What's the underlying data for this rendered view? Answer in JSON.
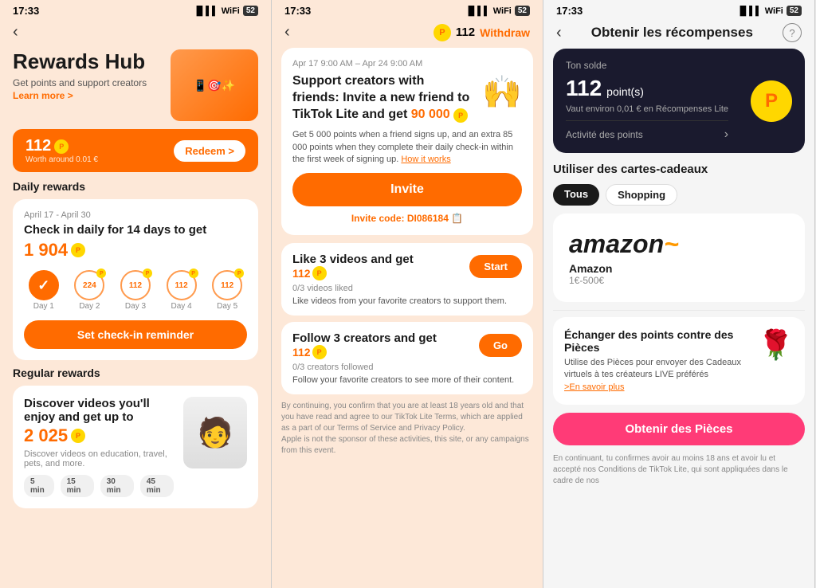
{
  "panel1": {
    "status_time": "17:33",
    "title": "Rewards Hub",
    "subtitle": "Get points and support creators",
    "learn_more": "Learn more >",
    "points_value": "112",
    "points_worth": "Worth around 0.01 €",
    "redeem_label": "Redeem >",
    "daily_title": "Daily rewards",
    "daily_date": "April 17 - April 30",
    "daily_heading": "Check in daily for 14 days to get",
    "daily_points": "1 904",
    "days": [
      {
        "label": "Day 1",
        "value": "✓",
        "checked": true
      },
      {
        "label": "Day 2",
        "value": "224"
      },
      {
        "label": "Day 3",
        "value": "112"
      },
      {
        "label": "Day 4",
        "value": "112"
      },
      {
        "label": "Day 5",
        "value": "112"
      }
    ],
    "reminder_btn": "Set check-in reminder",
    "regular_title": "Regular rewards",
    "regular_heading": "Discover videos you'll enjoy and get up to",
    "regular_points": "2 025",
    "regular_sub": "Discover videos on education, travel, pets, and more.",
    "times": [
      "5 min",
      "15 min",
      "30 min",
      "45 min"
    ]
  },
  "panel2": {
    "status_time": "17:33",
    "points_value": "112",
    "withdraw_label": "Withdraw",
    "promo_date": "Apr 17 9:00 AM – Apr 24 9:00 AM",
    "promo_title": "Support creators with friends: Invite a new friend to TikTok Lite and get",
    "promo_points": "90 000",
    "promo_desc": "Get 5 000 points when a friend signs up, and an extra 85 000 points when they complete their daily check-in within the first week of signing up.",
    "how_it_works": "How it works",
    "invite_btn": "Invite",
    "invite_code_label": "Invite code: DI086184",
    "like_title": "Like 3 videos and get",
    "like_points": "112",
    "like_start": "Start",
    "like_progress": "0/3 videos liked",
    "like_desc": "Like videos from your favorite creators to support them.",
    "follow_title": "Follow 3 creators and get",
    "follow_points": "112",
    "follow_go": "Go",
    "follow_progress": "0/3 creators followed",
    "follow_desc": "Follow your favorite creators to see more of their content.",
    "legal_text": "By continuing, you confirm that you are at least 18 years old and that you have read and agree to our TikTok Lite Terms, which are applied as a part of our Terms of Service and Privacy Policy.",
    "legal_note": "Apple is not the sponsor of these activities, this site, or any campaigns from this event."
  },
  "panel3": {
    "status_time": "17:33",
    "title": "Obtenir les récompenses",
    "balance_label": "Ton solde",
    "balance_value": "112",
    "balance_unit": "point(s)",
    "balance_worth": "Vaut environ 0,01 € en Récompenses Lite",
    "activity_label": "Activité des points",
    "use_cards_title": "Utiliser des cartes-cadeaux",
    "filter_all": "Tous",
    "filter_shopping": "Shopping",
    "amazon_name": "Amazon",
    "amazon_range": "1€-500€",
    "pieces_title": "Échanger des points contre des Pièces",
    "pieces_desc": "Utilise des Pièces pour envoyer des Cadeaux virtuels à tes créateurs LIVE préférés",
    "pieces_link": ">En savoir plus",
    "obtenir_btn": "Obtenir des Pièces",
    "legal_text": "En continuant, tu confirmes avoir au moins 18 ans et avoir lu et accepté nos Conditions de TikTok Lite, qui sont appliquées dans le cadre de nos"
  }
}
